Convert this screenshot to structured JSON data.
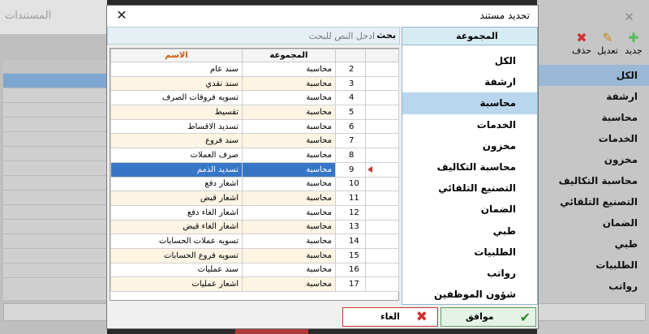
{
  "background_window_left": {
    "title": "المستندات"
  },
  "background_window_right": {
    "toolbar": {
      "new_label": "جديد",
      "edit_label": "تعديل",
      "delete_label": "حذف"
    },
    "groups": [
      "الكل",
      "ارشفة",
      "محاسبة",
      "الخدمات",
      "مخزون",
      "محاسبة التكاليف",
      "التصنيع التلقائي",
      "الضمان",
      "طبي",
      "الطلبيات",
      "رواتب"
    ]
  },
  "dialog": {
    "title": "تحديد مستند",
    "search": {
      "label": "بحث",
      "placeholder": "ادخل النص للبحث"
    },
    "group_pane": {
      "header": "المجموعة",
      "items": [
        "الكل",
        "ارشفة",
        "محاسبة",
        "الخدمات",
        "مخزون",
        "محاسبة التكاليف",
        "التصنيع التلقائي",
        "الضمان",
        "طبي",
        "الطلبيات",
        "رواتب",
        "شؤون الموظفين"
      ],
      "selected": "محاسبة"
    },
    "grid": {
      "columns": {
        "name": "الاسم",
        "group": "المجموعة"
      },
      "selected_row": 9,
      "rows": [
        {
          "num": "2",
          "group": "محاسبة",
          "name": "سند عام"
        },
        {
          "num": "3",
          "group": "محاسبة",
          "name": "سند نقدي"
        },
        {
          "num": "4",
          "group": "محاسبة",
          "name": "تسويه فروقات الصرف"
        },
        {
          "num": "5",
          "group": "محاسبة",
          "name": "تقسيط"
        },
        {
          "num": "6",
          "group": "محاسبة",
          "name": "تسديد الاقساط"
        },
        {
          "num": "7",
          "group": "محاسبة",
          "name": "سند فروع"
        },
        {
          "num": "8",
          "group": "محاسبة",
          "name": "صرف العملات"
        },
        {
          "num": "9",
          "group": "محاسبة",
          "name": "تسديد الذمم"
        },
        {
          "num": "10",
          "group": "محاسبة",
          "name": "اشعار دفع"
        },
        {
          "num": "11",
          "group": "محاسبة",
          "name": "اشعار قبض"
        },
        {
          "num": "12",
          "group": "محاسبة",
          "name": "اشعار الغاء دفع"
        },
        {
          "num": "13",
          "group": "محاسبة",
          "name": "اشعار الغاء قبض"
        },
        {
          "num": "14",
          "group": "محاسبة",
          "name": "تسويه عملات الحسابات"
        },
        {
          "num": "15",
          "group": "محاسبة",
          "name": "تسويه فروع الحسابات"
        },
        {
          "num": "16",
          "group": "محاسبة",
          "name": "سند عمليات"
        },
        {
          "num": "17",
          "group": "محاسبة",
          "name": "اشعار عمليات"
        }
      ]
    },
    "buttons": {
      "ok_label": "موافق",
      "cancel_label": "الغاء"
    }
  },
  "colors": {
    "selection_blue": "#3776c6",
    "group_selected": "#b9d6ee",
    "name_header": "#d35400",
    "row_alt": "#fdf4e3",
    "ok_green": "#2e8b2e",
    "cancel_red": "#d32f2f"
  }
}
